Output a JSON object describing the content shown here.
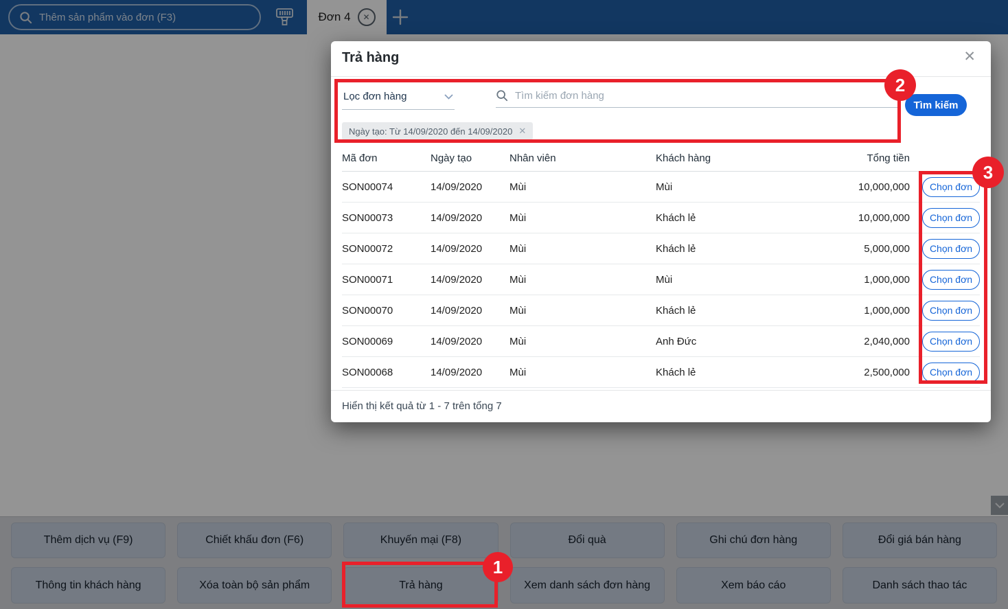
{
  "topbar": {
    "search_placeholder": "Thêm sản phẩm vào đơn (F3)",
    "tab_label": "Đơn 4",
    "icons": [
      "search-icon",
      "barcode-scanner-icon",
      "close-tab-icon",
      "add-tab-icon"
    ]
  },
  "modal": {
    "title": "Trả hàng",
    "filter": {
      "dropdown_label": "Lọc đơn hàng",
      "search_placeholder": "Tìm kiếm đơn hàng",
      "search_button_label": "Tìm kiếm",
      "active_filter_tag": "Ngày tạo: Từ 14/09/2020 đến 14/09/2020"
    },
    "table": {
      "columns": [
        "Mã đơn",
        "Ngày tạo",
        "Nhân viên",
        "Khách hàng",
        "Tổng tiền"
      ],
      "action_label": "Chọn đơn",
      "rows": [
        {
          "ma_don": "SON00074",
          "ngay_tao": "14/09/2020",
          "nhan_vien": "Mùi",
          "khach_hang": "Mùi",
          "tong_tien": "10,000,000"
        },
        {
          "ma_don": "SON00073",
          "ngay_tao": "14/09/2020",
          "nhan_vien": "Mùi",
          "khach_hang": "Khách lẻ",
          "tong_tien": "10,000,000"
        },
        {
          "ma_don": "SON00072",
          "ngay_tao": "14/09/2020",
          "nhan_vien": "Mùi",
          "khach_hang": "Khách lẻ",
          "tong_tien": "5,000,000"
        },
        {
          "ma_don": "SON00071",
          "ngay_tao": "14/09/2020",
          "nhan_vien": "Mùi",
          "khach_hang": "Mùi",
          "tong_tien": "1,000,000"
        },
        {
          "ma_don": "SON00070",
          "ngay_tao": "14/09/2020",
          "nhan_vien": "Mùi",
          "khach_hang": "Khách lẻ",
          "tong_tien": "1,000,000"
        },
        {
          "ma_don": "SON00069",
          "ngay_tao": "14/09/2020",
          "nhan_vien": "Mùi",
          "khach_hang": "Anh Đức",
          "tong_tien": "2,040,000"
        },
        {
          "ma_don": "SON00068",
          "ngay_tao": "14/09/2020",
          "nhan_vien": "Mùi",
          "khach_hang": "Khách lẻ",
          "tong_tien": "2,500,000"
        }
      ]
    },
    "footer_text": "Hiển thị kết quả từ 1 - 7 trên tổng 7"
  },
  "bottom_panel": {
    "buttons": [
      [
        "Thêm dịch vụ (F9)",
        "Chiết khấu đơn (F6)",
        "Khuyến mại (F8)",
        "Đổi quà",
        "Ghi chú đơn hàng",
        "Đổi giá bán hàng"
      ],
      [
        "Thông tin khách hàng",
        "Xóa toàn bộ sản phẩm",
        "Trả hàng",
        "Xem danh sách đơn hàng",
        "Xem báo cáo",
        "Danh sách thao tác"
      ]
    ]
  },
  "annotations": {
    "badge1": "1",
    "badge2": "2",
    "badge3": "3",
    "highlight_color": "#e9202a"
  },
  "colors": {
    "topbar_blue": "#1f5fa8",
    "accent_blue": "#1565d8",
    "annotation_red": "#e9202a"
  }
}
